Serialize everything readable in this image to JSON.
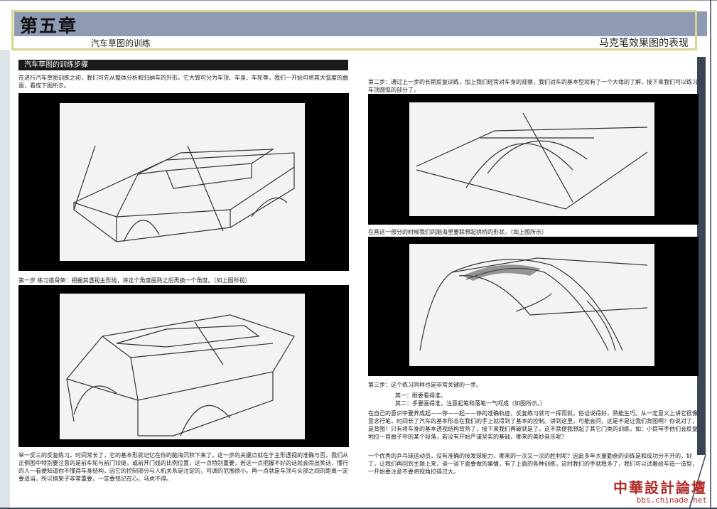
{
  "header": {
    "chapter": "第五章",
    "subtitle_left": "汽车草图的训练",
    "subtitle_right": "马克笔效果图的表现"
  },
  "left": {
    "section_title": "汽车草图的训练步骤",
    "intro": "在进行汽车草图训练之初，我们可先从整体分析和归纳车的外形。它大致可分为车顶、车身、车轮等，我们一开始可将其大弧度的曲面，看成下图所示。",
    "step1": "第一步 练习搭骨架：把握其透视主形线，将这个角度画熟之后再换一个角度。（如上图所视）",
    "bottom_text": "举一反三的反复练习，时间常长了，它的基本形就记忆在你的脑海沉积下来了。这一步的关键点就在于主形透视的准确与否，我们从正侧图中特别要注意的是前车轮与前门铰链，或前开门线的比例位置，这一点特别重要，若这一点把握不好的话就会闹出笑话，懂行的人一看便知道你不懂得车身结构，因它的控制部分与人机关系是注定的，可调的范围很小。再一点就是车顶与头部之间的距离一定要适当，所以搭架子非常重要，一定要铭记在心，马虎不得。"
  },
  "right": {
    "step2": "第二步：通过上一步的长期反复训练，加上我们经常对车身的观察，我们对车的基本型就有了一个大体的了解，接下来我们可以练习车顶圆弧的部分了。",
    "caption2": "在画这一部分的时候我们的脑海里要联想起拱桥的形状。（如上图所示）",
    "step3": "第三步：这个练习同样也是非常关键的一步。",
    "item1": "其一：眼要看得准。",
    "item2": "其二：手要画得准，注意起笔和落笔一气呵成（如图所示。）",
    "para1": "在自己的意识中要养成起——停——起——停的准确轨迹，反复练习就可一挥而就，俗话说得好，熟能生巧。从一定意义上讲它很像意念行笔，时间长了汽车的基本形态在我们的手上就得到了基本的控制。讲到这里，可能会问，这是不是让我们背图啊？你说对了，是背图！只有将车身的基本透视结构背熟了，接下来我们再破就是了。这不禁使我想起了其它门类的训练，如：小提琴手他们会反复地拉一首曲子中的某个段落，若没有开始严谨坚实的基础，哪来的美妙音乐呢？",
    "para2": "一个优秀的乒乓球运动员，没有准确的接发球能力，哪来的一次又一次的胜利呢？因此多年大量勤奋的训练是和成功分不开的。好了，让我们再回到主题上来，谈一谈下面要做的事情，有了上面的各种训练，这时我们的手就稳多了，我们可以试着给车造一造型，一开始要注意不要将视角拉得过大。"
  },
  "watermark": {
    "cn": "中華設計論壇",
    "url": "bbs.chinade.net"
  },
  "colors": {
    "header_band": "#8f9bb5",
    "frame": "#d8d78c",
    "watermark": "#b12a27"
  }
}
